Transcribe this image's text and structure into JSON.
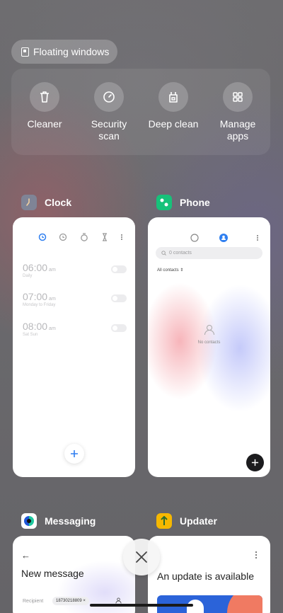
{
  "floating_windows": {
    "label": "Floating windows",
    "icon": "floating-window-icon"
  },
  "tools": [
    {
      "label": "Cleaner",
      "icon": "trash-icon"
    },
    {
      "label": "Security\nscan",
      "icon": "shield-check-icon"
    },
    {
      "label": "Deep clean",
      "icon": "deep-clean-icon"
    },
    {
      "label": "Manage\napps",
      "icon": "grid-icon"
    }
  ],
  "apps": {
    "clock": {
      "name": "Clock",
      "alarms": [
        {
          "time": "06:00",
          "ampm": "am",
          "repeat": "Daily"
        },
        {
          "time": "07:00",
          "ampm": "am",
          "repeat": "Monday to Friday"
        },
        {
          "time": "08:00",
          "ampm": "am",
          "repeat": "Sat Sun"
        }
      ]
    },
    "phone": {
      "name": "Phone",
      "search_placeholder": "0 contacts",
      "filter": "All contacts",
      "empty_text": "No contacts"
    },
    "messaging": {
      "name": "Messaging",
      "title": "New message",
      "recipient_label": "Recipient",
      "recipient_value": "18730218809"
    },
    "updater": {
      "name": "Updater",
      "title": "An update is available"
    }
  },
  "colors": {
    "accent_blue": "#2f7ff0",
    "phone_green": "#16c27a",
    "updater_yellow": "#f6b800"
  }
}
